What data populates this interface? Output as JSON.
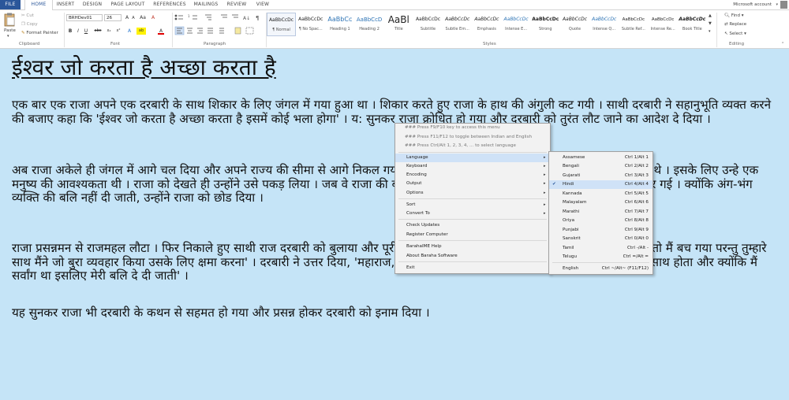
{
  "tabs": [
    {
      "label": "FILE"
    },
    {
      "label": "HOME"
    },
    {
      "label": "INSERT"
    },
    {
      "label": "DESIGN"
    },
    {
      "label": "PAGE LAYOUT"
    },
    {
      "label": "REFERENCES"
    },
    {
      "label": "MAILINGS"
    },
    {
      "label": "REVIEW"
    },
    {
      "label": "VIEW"
    }
  ],
  "account": {
    "name": "Microsoft account"
  },
  "ribbon": {
    "clipboard": {
      "group": "Clipboard",
      "paste": "Paste",
      "cut": "Cut",
      "copy": "Copy",
      "format_painter": "Format Painter"
    },
    "font": {
      "group": "Font",
      "name": "BRHDev01",
      "size": "26",
      "bold": "B",
      "italic": "I",
      "underline": "U",
      "strike": "abc",
      "sub": "x₂",
      "sup": "x²",
      "grow": "A",
      "shrink": "A",
      "case": "Aa",
      "clear": "A",
      "highlight": "ab",
      "color": "A"
    },
    "paragraph": {
      "group": "Paragraph"
    },
    "styles": {
      "group": "Styles",
      "items": [
        {
          "preview": "AaBbCcDc",
          "name": "¶ Normal"
        },
        {
          "preview": "AaBbCcDc",
          "name": "¶ No Spac..."
        },
        {
          "preview": "AaBbCc",
          "name": "Heading 1"
        },
        {
          "preview": "AaBbCcD",
          "name": "Heading 2"
        },
        {
          "preview": "AaBl",
          "name": "Title"
        },
        {
          "preview": "AaBbCcDc",
          "name": "Subtitle"
        },
        {
          "preview": "AaBbCcDc",
          "name": "Subtle Em..."
        },
        {
          "preview": "AaBbCcDc",
          "name": "Emphasis"
        },
        {
          "preview": "AaBbCcDc",
          "name": "Intense E..."
        },
        {
          "preview": "AaBbCcDc",
          "name": "Strong"
        },
        {
          "preview": "AaBbCcDc",
          "name": "Quote"
        },
        {
          "preview": "AaBbCcDc",
          "name": "Intense Q..."
        },
        {
          "preview": "AaBbCcDc",
          "name": "Subtle Ref..."
        },
        {
          "preview": "AaBbCcDc",
          "name": "Intense Re..."
        },
        {
          "preview": "AaBbCcDc",
          "name": "Book Title"
        }
      ]
    },
    "editing": {
      "group": "Editing",
      "find": "Find",
      "replace": "Replace",
      "select": "Select"
    }
  },
  "document": {
    "title": "ईश्वर जो करता है अच्छा करता है",
    "p1": "एक बार एक राजा अपने एक दरबारी के साथ शिकार के लिए जंगल में गया हुआ था । शिकार करते हुए राजा के हाथ की अंगुली कट गयी । साथी दरबारी ने सहानुभूति व्यक्त करने की बजाए कहा कि 'ईश्वर जो करता है अच्छा करता है इसमें कोई भला होगा' । य: सुनकर राजा क्रोधित हो गया और दरबारी को तुरंत लौट जाने का आदेश दे दिया ।",
    "p2": "अब राजा अकेले ही जंगल में आगे चल दिया और अपने राज्य की सीमा से आगे निकल गया । वहाँ कुछ आदिवासी लोग नर बलि देने की तैयारी कर रहे थे । इसके लिए उन्हे एक मनुष्य की आवश्यकता थी । राजा को देखते ही उन्होंने उसे पकड़ लिया । जब वे राजा की बलि चढाने लगे, तब उनकी नज़र राजा की कटी हुई अंगुली पर गई । क्योंकि अंग-भंग व्यक्ति की बलि नहीं दी जाती, उन्होंने राजा को छोड दिया ।",
    "p3": "राजा प्रसन्नमन से राजमहल लौटा । फिर निकाले हुए साथी राज दरबारी को बुलाया और पूरी घटना सुनाई और कहा कि 'मेरी अंगुली कट जाने के कारण तो मैं बच गया परन्तु तुम्हारे साथ मैंने जो बुरा व्यवहार किया उसके लिए क्षमा करना' । दरबारी ने उत्तर दिया, 'महाराज, यदि आप मुझे लौटने के लिए नहीं कहते तो मैं वहां आप के साथ होता और क्योंकि मैं सर्वांग था इसलिए मेरी बलि दे दी जाती' ।",
    "p4": "यह सुनकर राजा भी दरबारी के कथन से सहमत हो गया और प्रसन्न होकर दरबारी को इनाम दिया ।"
  },
  "context_menu": {
    "hints": [
      "### Press F9/F10 key to access this menu",
      "### Press F11/F12 to toggle between Indian and English",
      "### Press Ctrl/Alt 1, 2, 3, 4, ... to select language"
    ],
    "items": [
      {
        "label": "Language",
        "submenu": true,
        "highlighted": true
      },
      {
        "label": "Keyboard",
        "submenu": true
      },
      {
        "label": "Encoding",
        "submenu": true
      },
      {
        "label": "Output",
        "submenu": true
      },
      {
        "label": "Options",
        "submenu": true
      },
      {
        "label": "Sort",
        "submenu": true
      },
      {
        "label": "Convert To",
        "submenu": true
      },
      {
        "label": "Check Updates"
      },
      {
        "label": "Register Computer"
      },
      {
        "label": "BarahaIME Help"
      },
      {
        "label": "About Baraha Software"
      },
      {
        "label": "Exit"
      }
    ]
  },
  "language_menu": {
    "items": [
      {
        "label": "Assamese",
        "shortcut": "Ctrl 1/Alt 1"
      },
      {
        "label": "Bengali",
        "shortcut": "Ctrl 2/Alt 2"
      },
      {
        "label": "Gujarati",
        "shortcut": "Ctrl 3/Alt 3"
      },
      {
        "label": "Hindi",
        "shortcut": "Ctrl 4/Alt 4",
        "checked": true
      },
      {
        "label": "Kannada",
        "shortcut": "Ctrl 5/Alt 5"
      },
      {
        "label": "Malayalam",
        "shortcut": "Ctrl 6/Alt 6"
      },
      {
        "label": "Marathi",
        "shortcut": "Ctrl 7/Alt 7"
      },
      {
        "label": "Oriya",
        "shortcut": "Ctrl 8/Alt 8"
      },
      {
        "label": "Punjabi",
        "shortcut": "Ctrl 9/Alt 9"
      },
      {
        "label": "Sanskrit",
        "shortcut": "Ctrl 0/Alt 0"
      },
      {
        "label": "Tamil",
        "shortcut": "Ctrl -/Alt -"
      },
      {
        "label": "Telugu",
        "shortcut": "Ctrl =/Alt ="
      },
      {
        "label": "English",
        "shortcut": "Ctrl ~/Alt~ (F11/F12)"
      }
    ],
    "check_mark": "✔"
  },
  "colors": {
    "accent": "#2b579a",
    "doc_background": "#c5e4f7",
    "menu_highlight": "#cfe2f7"
  }
}
